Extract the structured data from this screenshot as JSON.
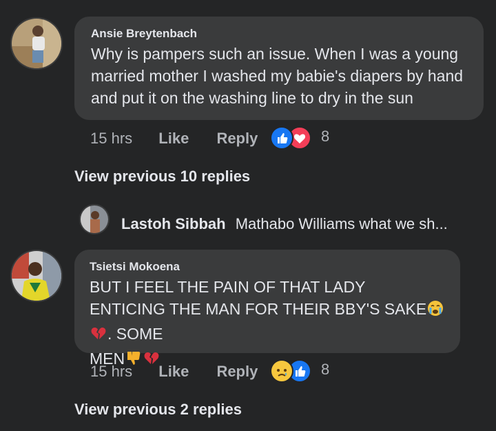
{
  "comments": [
    {
      "author": "Ansie Breytenbach",
      "text": "Why is pampers such an issue. When I was a young married mother I washed my babie's diapers by hand and put it on the washing line to dry in the sun",
      "time": "15 hrs",
      "like_label": "Like",
      "reply_label": "Reply",
      "reactions": [
        "like-icon",
        "love-icon"
      ],
      "reaction_count": "8",
      "view_replies": "View previous 10 replies"
    },
    {
      "author": "Tsietsi Mokoena",
      "text_part1": "BUT I FEEL THE PAIN OF THAT LADY ENTICING THE MAN FOR THEIR BBY'S SAKE",
      "text_part2": ". SOME",
      "text_part3": "MEN",
      "inline_emojis": [
        "crying-face-emoji",
        "broken-heart-emoji",
        "thumbs-down-emoji",
        "broken-heart-emoji"
      ],
      "time": "15 hrs",
      "like_label": "Like",
      "reply_label": "Reply",
      "reactions": [
        "sad-icon",
        "like-icon"
      ],
      "reaction_count": "8",
      "view_replies": "View previous 2 replies"
    }
  ],
  "reply_preview": {
    "author": "Lastoh Sibbah",
    "text": "Mathabo Williams what we sh..."
  },
  "colors": {
    "background": "#242526",
    "bubble": "#3a3b3c",
    "like_blue": "#1877f2",
    "love_red": "#f33e58",
    "broken_heart": "#d9313e"
  }
}
